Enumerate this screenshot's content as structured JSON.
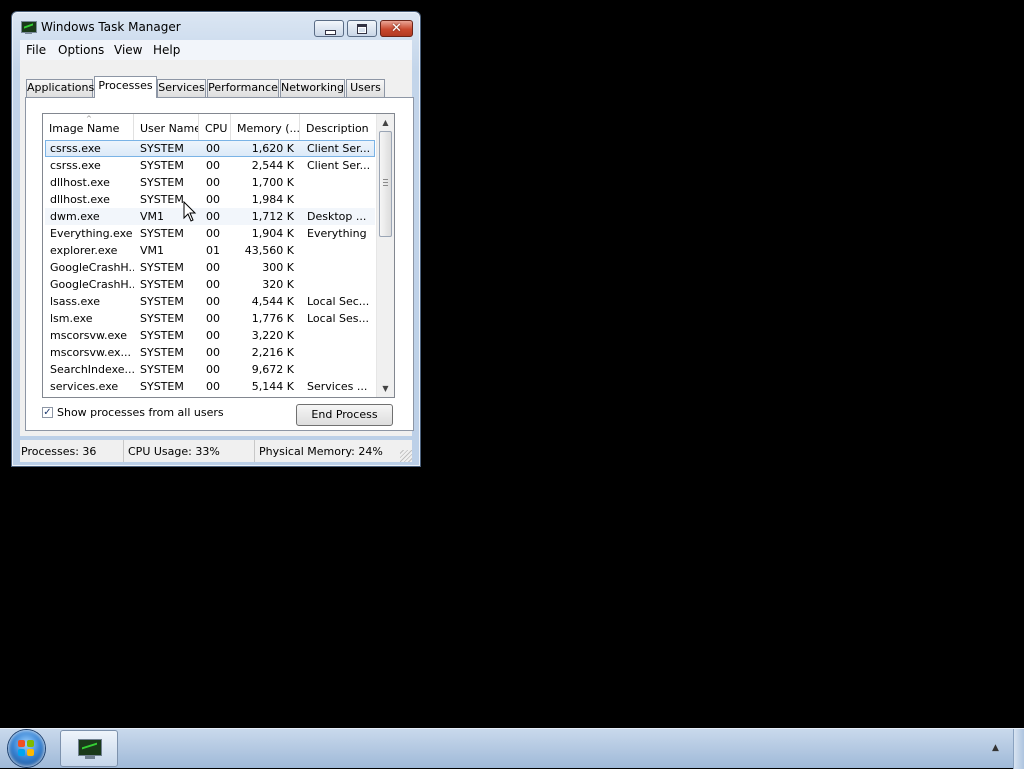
{
  "window": {
    "title": "Windows Task Manager",
    "menu": [
      "File",
      "Options",
      "View",
      "Help"
    ],
    "close_glyph": "✕",
    "tabs": [
      "Applications",
      "Processes",
      "Services",
      "Performance",
      "Networking",
      "Users"
    ],
    "active_tab": "Processes",
    "columns": [
      "Image Name",
      "User Name",
      "CPU",
      "Memory (...",
      "Description"
    ],
    "sort_indicator": "^",
    "processes": [
      [
        "csrss.exe",
        "SYSTEM",
        "00",
        "1,620 K",
        "Client Ser..."
      ],
      [
        "csrss.exe",
        "SYSTEM",
        "00",
        "2,544 K",
        "Client Ser..."
      ],
      [
        "dllhost.exe",
        "SYSTEM",
        "00",
        "1,700 K",
        ""
      ],
      [
        "dllhost.exe",
        "SYSTEM",
        "00",
        "1,984 K",
        ""
      ],
      [
        "dwm.exe",
        "VM1",
        "00",
        "1,712 K",
        "Desktop ..."
      ],
      [
        "Everything.exe",
        "SYSTEM",
        "00",
        "1,904 K",
        "Everything"
      ],
      [
        "explorer.exe",
        "VM1",
        "01",
        "43,560 K",
        ""
      ],
      [
        "GoogleCrashH...",
        "SYSTEM",
        "00",
        "300 K",
        ""
      ],
      [
        "GoogleCrashH...",
        "SYSTEM",
        "00",
        "320 K",
        ""
      ],
      [
        "lsass.exe",
        "SYSTEM",
        "00",
        "4,544 K",
        "Local Sec..."
      ],
      [
        "lsm.exe",
        "SYSTEM",
        "00",
        "1,776 K",
        "Local Ses..."
      ],
      [
        "mscorsvw.exe",
        "SYSTEM",
        "00",
        "3,220 K",
        ""
      ],
      [
        "mscorsvw.ex...",
        "SYSTEM",
        "00",
        "2,216 K",
        ""
      ],
      [
        "SearchIndexe...",
        "SYSTEM",
        "00",
        "9,672 K",
        ""
      ],
      [
        "services.exe",
        "SYSTEM",
        "00",
        "5,144 K",
        "Services ..."
      ]
    ],
    "selected_row": 0,
    "hover_row": 4,
    "show_all_users": {
      "label": "Show processes from all users",
      "checked": true,
      "check_glyph": "✓"
    },
    "end_process_label": "End Process",
    "status": [
      "Processes: 36",
      "CPU Usage: 33%",
      "Physical Memory: 24%"
    ],
    "scroll_up_glyph": "▲",
    "scroll_down_glyph": "▼"
  },
  "taskbar": {
    "pinned": [
      {
        "icon": "task-manager-icon"
      }
    ],
    "tray_arrow_glyph": "▲"
  }
}
